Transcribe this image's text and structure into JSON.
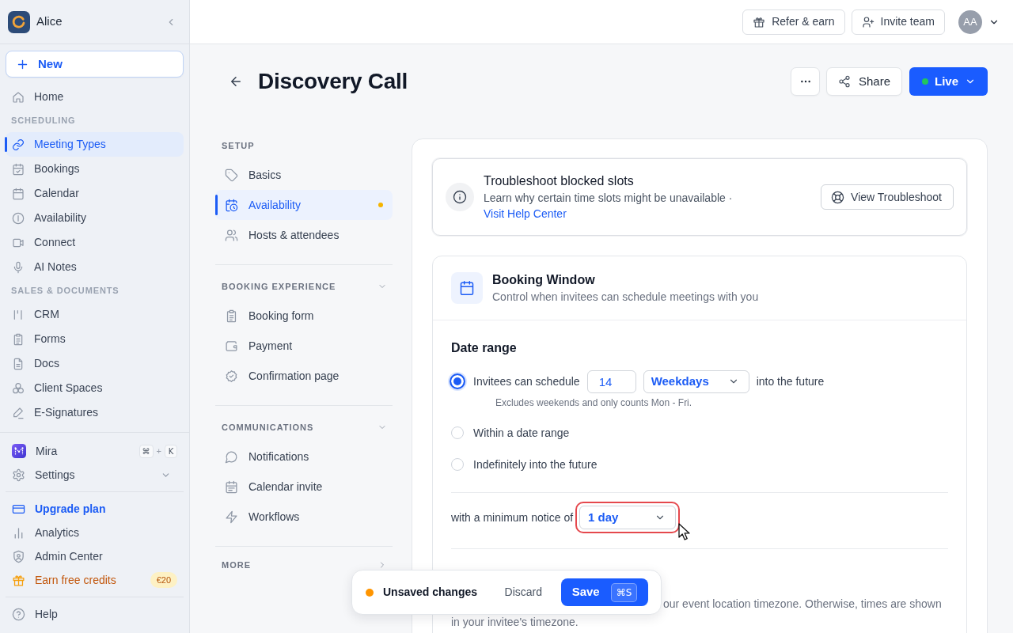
{
  "sidebar": {
    "workspace_name": "Alice",
    "new_label": "New",
    "groups": [
      {
        "items": [
          {
            "label": "Home",
            "selected": false
          }
        ]
      },
      {
        "heading": "SCHEDULING",
        "items": [
          {
            "label": "Meeting Types",
            "selected": true
          },
          {
            "label": "Bookings",
            "selected": false
          },
          {
            "label": "Calendar",
            "selected": false
          },
          {
            "label": "Availability",
            "selected": false
          },
          {
            "label": "Connect",
            "selected": false
          },
          {
            "label": "AI Notes",
            "selected": false
          }
        ]
      },
      {
        "heading": "SALES & DOCUMENTS",
        "items": [
          {
            "label": "CRM",
            "selected": false
          },
          {
            "label": "Forms",
            "selected": false
          },
          {
            "label": "Docs",
            "selected": false
          },
          {
            "label": "Client Spaces",
            "selected": false
          },
          {
            "label": "E-Signatures",
            "selected": false
          }
        ]
      }
    ],
    "footer_groups": [
      [
        {
          "kind": "assistant",
          "label": "Mira",
          "shortcut": {
            "keys": [
              "⌘",
              "K"
            ],
            "joiner": "+"
          }
        },
        {
          "kind": "menu",
          "label": "Settings",
          "expanded": false
        }
      ],
      [
        {
          "kind": "upgrade",
          "label": "Upgrade plan"
        },
        {
          "kind": "plain",
          "label": "Analytics"
        },
        {
          "kind": "plain",
          "label": "Admin Center"
        },
        {
          "kind": "promo",
          "label": "Earn free credits",
          "badge": "€20"
        }
      ],
      [
        {
          "kind": "plain",
          "label": "Help"
        }
      ]
    ]
  },
  "top_bar": {
    "buttons": [
      "Refer & earn",
      "Invite team"
    ],
    "account_initials": "AA"
  },
  "page": {
    "title": "Discovery Call",
    "share_label": "Share",
    "status": {
      "label": "Live",
      "live": true
    }
  },
  "settings_nav": [
    {
      "heading": "SETUP",
      "items": [
        {
          "label": "Basics",
          "selected": false,
          "unsaved": false
        },
        {
          "label": "Availability",
          "selected": true,
          "unsaved": true
        },
        {
          "label": "Hosts & attendees",
          "selected": false,
          "unsaved": false
        }
      ]
    },
    {
      "heading": "BOOKING EXPERIENCE",
      "expanded": true,
      "items": [
        {
          "label": "Booking form",
          "selected": false,
          "unsaved": false
        },
        {
          "label": "Payment",
          "selected": false,
          "unsaved": false
        },
        {
          "label": "Confirmation page",
          "selected": false,
          "unsaved": false
        }
      ]
    },
    {
      "heading": "COMMUNICATIONS",
      "expanded": true,
      "items": [
        {
          "label": "Notifications",
          "selected": false,
          "unsaved": false
        },
        {
          "label": "Calendar invite",
          "selected": false,
          "unsaved": false
        },
        {
          "label": "Workflows",
          "selected": false,
          "unsaved": false
        }
      ]
    },
    {
      "heading": "MORE",
      "expanded": false
    }
  ],
  "troubleshoot": {
    "title": "Troubleshoot blocked slots",
    "text": "Learn why certain time slots might be unavailable ·",
    "link": "Visit Help Center",
    "button": "View Troubleshoot"
  },
  "booking_window": {
    "title": "Booking Window",
    "subtitle": "Control when invitees can schedule meetings with you",
    "date_range": {
      "heading": "Date range",
      "options": [
        {
          "kind": "rolling",
          "selected": true,
          "label": "Invitees can schedule",
          "amount": "14",
          "unit": "Weekdays",
          "suffix": "into the future",
          "hint": "Excludes weekends and only counts Mon - Fri."
        },
        {
          "kind": "plain",
          "selected": false,
          "label": "Within a date range"
        },
        {
          "kind": "plain",
          "selected": false,
          "label": "Indefinitely into the future"
        }
      ]
    },
    "minimum_notice": {
      "label": "with a minimum notice of",
      "value": "1 day",
      "focused": true
    },
    "timezone_note": {
      "lines": [
        "our event location timezone. Otherwise, times are shown",
        "in your invitee's timezone."
      ]
    }
  },
  "unsaved_bar": {
    "label": "Unsaved changes",
    "discard_label": "Discard",
    "save_label": "Save",
    "save_shortcut": "⌘S"
  }
}
